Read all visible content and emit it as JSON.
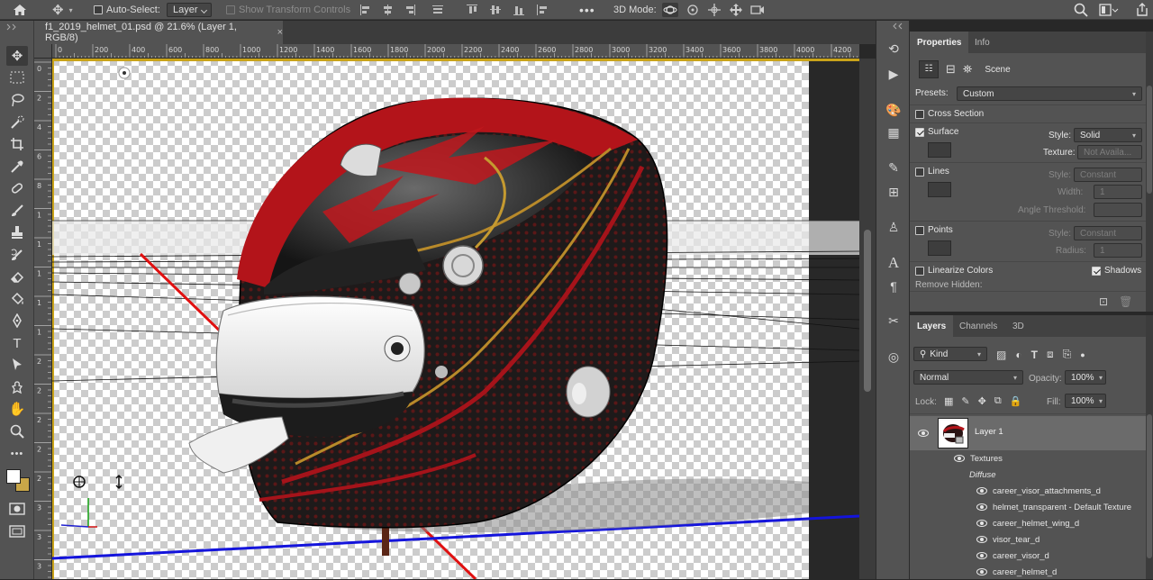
{
  "options_bar": {
    "auto_select_label": "Auto-Select:",
    "auto_select_target": "Layer",
    "show_transform_label": "Show Transform Controls",
    "mode_3d_label": "3D Mode:"
  },
  "document": {
    "tab_title": "f1_2019_helmet_01.psd @ 21.6% (Layer 1, RGB/8)",
    "close_glyph": "×"
  },
  "ruler_h": [
    "0",
    "200",
    "400",
    "600",
    "800",
    "1000",
    "1200",
    "1400",
    "1600",
    "1800",
    "2000",
    "2200",
    "2400",
    "2600",
    "2800",
    "3000",
    "3200",
    "3400",
    "3600",
    "3800",
    "4000",
    "4200"
  ],
  "ruler_v": [
    "0",
    "2",
    "4",
    "6",
    "8",
    "1",
    "1",
    "1",
    "1",
    "1",
    "2",
    "2",
    "2",
    "2",
    "2",
    "3",
    "3",
    "3"
  ],
  "properties": {
    "tabs": [
      "Properties",
      "Info"
    ],
    "scene_label": "Scene",
    "presets_label": "Presets:",
    "presets_value": "Custom",
    "cross_section_label": "Cross Section",
    "surface_label": "Surface",
    "surface_style_label": "Style:",
    "surface_style_value": "Solid",
    "texture_label": "Texture:",
    "texture_value": "Not Availa...",
    "lines_label": "Lines",
    "lines_style_label": "Style:",
    "lines_style_value": "Constant",
    "width_label": "Width:",
    "width_value": "1",
    "angle_label": "Angle Threshold:",
    "points_label": "Points",
    "points_style_label": "Style:",
    "points_style_value": "Constant",
    "radius_label": "Radius:",
    "radius_value": "1",
    "linearize_label": "Linearize Colors",
    "shadows_label": "Shadows",
    "remove_hidden_label": "Remove Hidden:"
  },
  "layers": {
    "tabs": [
      "Layers",
      "Channels",
      "3D"
    ],
    "kind_label": "Kind",
    "blend_mode": "Normal",
    "opacity_label": "Opacity:",
    "opacity_value": "100%",
    "lock_label": "Lock:",
    "fill_label": "Fill:",
    "fill_value": "100%",
    "layer_name": "Layer 1",
    "textures_label": "Textures",
    "diffuse_label": "Diffuse",
    "texture_items": [
      "career_visor_attachments_d",
      "helmet_transparent - Default Texture",
      "career_helmet_wing_d",
      "visor_tear_d",
      "career_visor_d",
      "career_helmet_d"
    ]
  }
}
